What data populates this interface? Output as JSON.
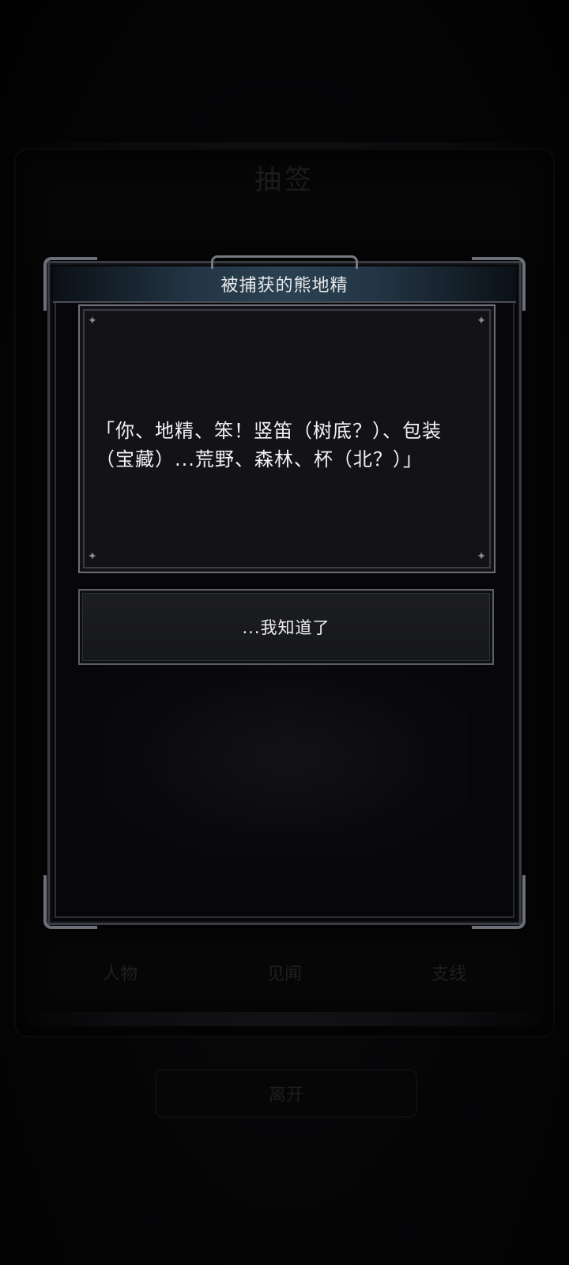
{
  "background": {
    "title": "抽签",
    "tabs": [
      "人物",
      "见闻",
      "支线"
    ],
    "leave_label": "离开"
  },
  "modal": {
    "title": "被捕获的熊地精",
    "dialog_text": "「你、地精、笨！竖笛（树底？）、包装（宝藏）...荒野、森林、杯（北？）」",
    "reply_label": "...我知道了"
  },
  "colors": {
    "title_bar_accent": "#2b4252",
    "frame_silver": "#6d7079",
    "dialog_bg": "#131317",
    "text": "#f2f2f4"
  }
}
